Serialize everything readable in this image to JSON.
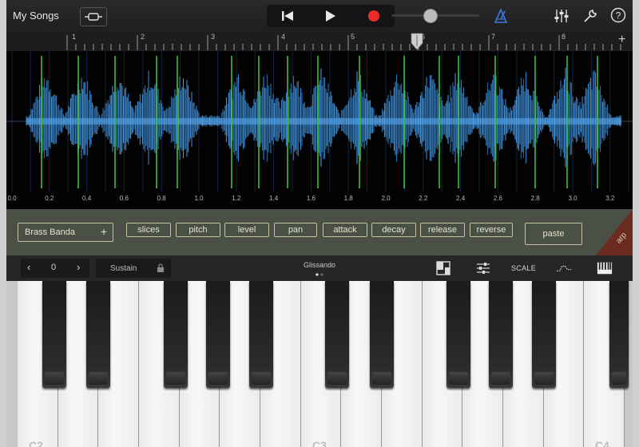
{
  "app": {
    "my_songs": "My Songs"
  },
  "ruler": {
    "bars": [
      "1",
      "2",
      "3",
      "4",
      "5",
      "6",
      "7",
      "8"
    ]
  },
  "waveform": {
    "time_ticks": [
      "0.0",
      "0.2",
      "0.4",
      "0.6",
      "0.8",
      "1.0",
      "1.2",
      "1.4",
      "1.6",
      "1.8",
      "2.0",
      "2.2",
      "2.4",
      "2.6",
      "2.8",
      "3.0",
      "3.2"
    ],
    "colors": {
      "wave": "#3f8fd8",
      "marker": "#38c33a",
      "background": "#020202"
    }
  },
  "controls": {
    "preset": "Brass Banda",
    "buttons": [
      "slices",
      "pitch",
      "level",
      "pan",
      "attack",
      "decay",
      "release",
      "reverse"
    ],
    "paste": "paste",
    "arp": "arp"
  },
  "keyboard": {
    "octave": "0",
    "sustain": "Sustain",
    "glissando": "Glissando",
    "scale": "SCALE",
    "key_labels": [
      "C2",
      "C3",
      "C4"
    ]
  },
  "icons": [
    "loop-browser-icon",
    "rewind-icon",
    "play-icon",
    "record-icon",
    "metronome-icon",
    "mixer-icon",
    "settings-wrench-icon",
    "help-icon",
    "add-track-icon",
    "lock-icon",
    "keyboard-layout-icon",
    "controls-icon",
    "arpeggiator-icon",
    "piano-keys-icon"
  ]
}
